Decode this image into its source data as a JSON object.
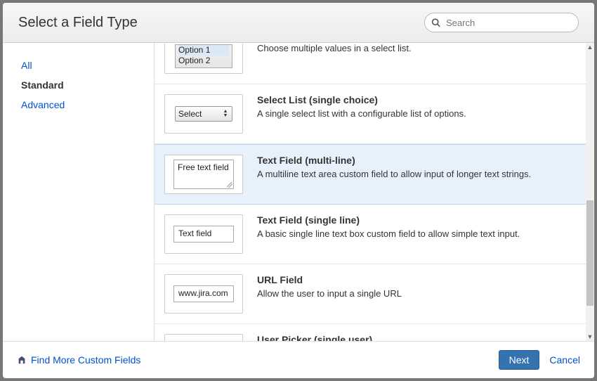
{
  "header": {
    "title": "Select a Field Type",
    "search_placeholder": "Search"
  },
  "sidebar": {
    "items": [
      {
        "label": "All",
        "active": false
      },
      {
        "label": "Standard",
        "active": true
      },
      {
        "label": "Advanced",
        "active": false
      }
    ]
  },
  "fieldTypes": [
    {
      "title": "",
      "desc": "Choose multiple values in a select list.",
      "preview_option1": "Option 1",
      "preview_option2": "Option 2",
      "selected": false,
      "partial": "top"
    },
    {
      "title": "Select List (single choice)",
      "desc": "A single select list with a configurable list of options.",
      "preview_select_label": "Select",
      "selected": false
    },
    {
      "title": "Text Field (multi-line)",
      "desc": "A multiline text area custom field to allow input of longer text strings.",
      "preview_textarea_text": "Free text field",
      "selected": true
    },
    {
      "title": "Text Field (single line)",
      "desc": "A basic single line text box custom field to allow simple text input.",
      "preview_textfield_text": "Text field",
      "selected": false
    },
    {
      "title": "URL Field",
      "desc": "Allow the user to input a single URL",
      "preview_textfield_text": "www.jira.com",
      "selected": false
    },
    {
      "title": "User Picker (single user)",
      "desc": "",
      "selected": false,
      "partial": "bottom"
    }
  ],
  "footer": {
    "find_more": "Find More Custom Fields",
    "next": "Next",
    "cancel": "Cancel"
  }
}
